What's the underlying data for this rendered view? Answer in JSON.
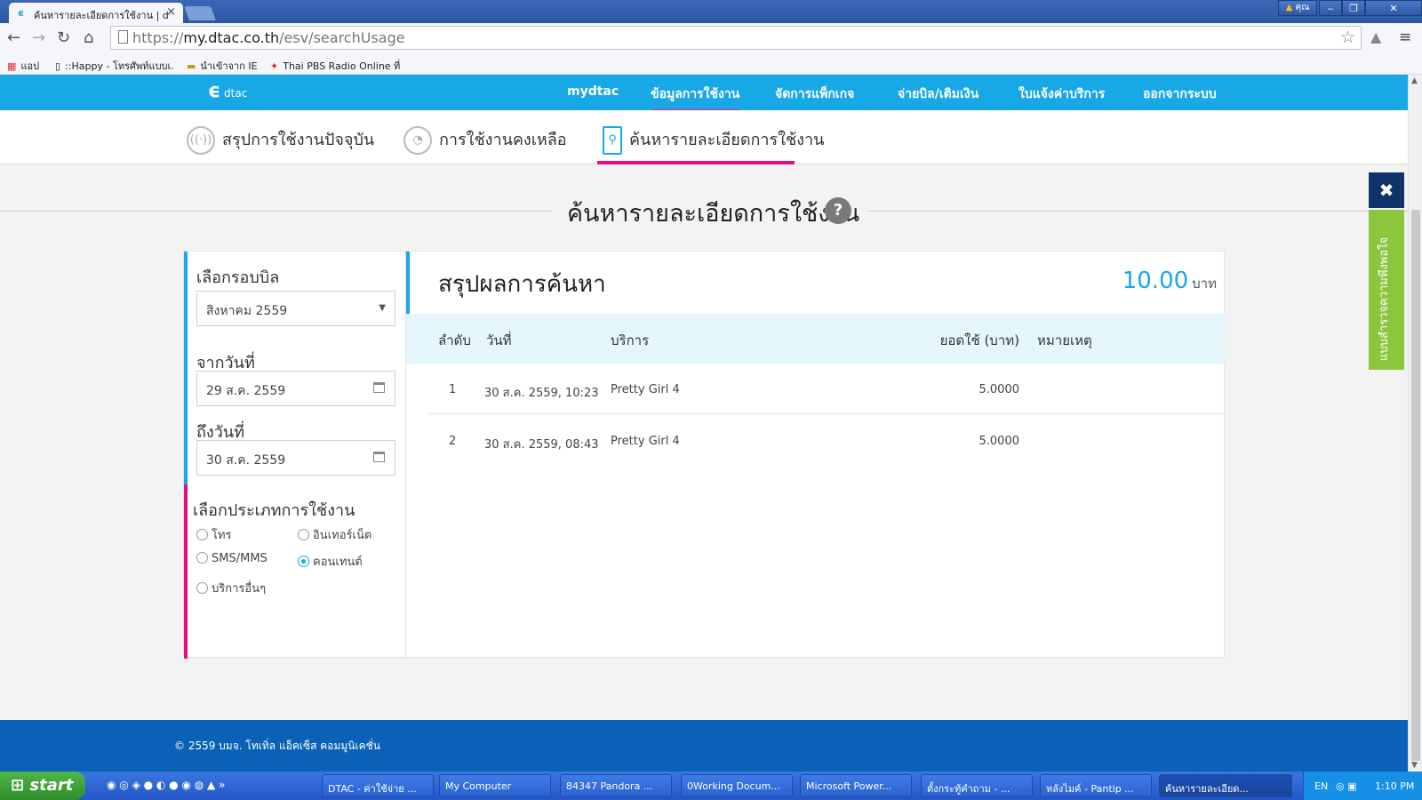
{
  "browser": {
    "tab_title": "ค้นหารายละเอียดการใช้งาน | d",
    "tab_close": "×",
    "user_label": "คุณ",
    "window_controls": [
      "‒",
      "❐",
      "✕"
    ],
    "url_prefix": "https://",
    "url_host": "my.dtac.co.th",
    "url_path": "/esv/searchUsage",
    "bookmarks": [
      {
        "label": "แอป",
        "icon": "apps-grid-icon"
      },
      {
        "label": "::Happy - โทรศัพท์แบบเ...",
        "icon": "page-icon"
      },
      {
        "label": "นำเข้าจาก IE",
        "icon": "folder-icon"
      },
      {
        "label": "Thai PBS Radio Online ที่",
        "icon": "radio-icon"
      }
    ]
  },
  "site": {
    "logo_text": "dtac",
    "nav": [
      "mydtac",
      "ข้อมูลการใช้งาน",
      "จัดการแพ็กเกจ",
      "จ่ายบิล/เติมเงิน",
      "ใบแจ้งค่าบริการ",
      "ออกจากระบบ"
    ],
    "nav_active": 1,
    "subnav": [
      "สรุปการใช้งานปัจจุบัน",
      "การใช้งานคงเหลือ",
      "ค้นหารายละเอียดการใช้งาน"
    ],
    "subnav_active": 2,
    "page_title": "ค้นหารายละเอียดการใช้งาน",
    "help_label": "?"
  },
  "filters": {
    "bill_cycle_label": "เลือกรอบบิล",
    "bill_cycle_value": "สิงหาคม 2559",
    "from_label": "จากวันที่",
    "from_value": "29 ส.ค. 2559",
    "to_label": "ถึงวันที่",
    "to_value": "30 ส.ค. 2559",
    "type_label": "เลือกประเภทการใช้งาน",
    "types": [
      {
        "label": "โทร",
        "checked": false
      },
      {
        "label": "อินเทอร์เน็ต",
        "checked": false
      },
      {
        "label": "SMS/MMS",
        "checked": false
      },
      {
        "label": "คอนเทนต์",
        "checked": true
      },
      {
        "label": "บริการอื่นๆ",
        "checked": false
      }
    ]
  },
  "results": {
    "title": "สรุปผลการค้นหา",
    "total": "10.00",
    "currency": "บาท",
    "columns": [
      "ลำดับ",
      "วันที่",
      "บริการ",
      "ยอดใช้ (บาท)",
      "หมายเหตุ"
    ],
    "rows": [
      {
        "no": "1",
        "date": "30 ส.ค. 2559, 10:23",
        "service": "Pretty Girl 4",
        "amount": "5.0000",
        "note": ""
      },
      {
        "no": "2",
        "date": "30 ส.ค. 2559, 08:43",
        "service": "Pretty Girl 4",
        "amount": "5.0000",
        "note": ""
      }
    ]
  },
  "feedback": {
    "close": "✖",
    "label": "แบบสำรวจความพึงพอใจ"
  },
  "footer": {
    "copyright": "© 2559 บมจ. โทเทิ่ล แอ็คเซ็ส คอมมูนิเคชั่น"
  },
  "taskbar": {
    "start": "start",
    "quick_more": "»",
    "tasks": [
      "DTAC - ค่าใช้จ่าย ...",
      "My Computer",
      "84347 Pandora ...",
      "0Working Docum...",
      "Microsoft Power...",
      "ตั้งกระทู้คำถาม - ...",
      "หลังไมค์ - Pantip ...",
      "ค้นหารายละเอียด..."
    ],
    "active_task": 7,
    "lang": "EN",
    "clock": "1:10 PM"
  },
  "colors": {
    "brand_blue": "#18a8e5",
    "brand_pink": "#e6117d",
    "footer_blue": "#0a62b7",
    "feedback_green": "#8cc63e"
  }
}
